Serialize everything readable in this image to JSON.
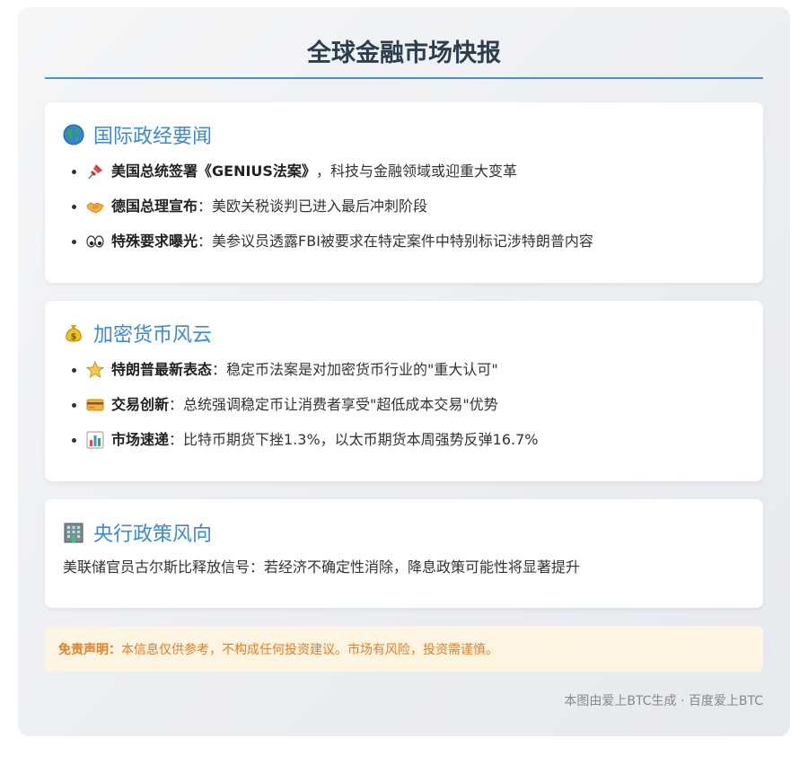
{
  "header": {
    "title": "全球金融市场快报"
  },
  "sections": [
    {
      "icon": "globe-icon",
      "title": "国际政经要闻",
      "items": [
        {
          "icon": "pushpin-icon",
          "bold": "美国总统签署《GENIUS法案》",
          "text": "，科技与金融领域或迎重大变革"
        },
        {
          "icon": "handshake-icon",
          "bold": "德国总理宣布",
          "text": "：美欧关税谈判已进入最后冲刺阶段"
        },
        {
          "icon": "eyes-icon",
          "bold": "特殊要求曝光",
          "text": "：美参议员透露FBI被要求在特定案件中特别标记涉特朗普内容"
        }
      ]
    },
    {
      "icon": "money-bag-icon",
      "title": "加密货币风云",
      "items": [
        {
          "icon": "star-icon",
          "bold": "特朗普最新表态",
          "text": "：稳定币法案是对加密货币行业的\"重大认可\""
        },
        {
          "icon": "credit-card-icon",
          "bold": "交易创新",
          "text": "：总统强调稳定币让消费者享受\"超低成本交易\"优势"
        },
        {
          "icon": "bar-chart-icon",
          "bold": "市场速递",
          "text": "：比特币期货下挫1.3%，以太币期货本周强势反弹16.7%"
        }
      ]
    },
    {
      "icon": "office-building-icon",
      "title": "央行政策风向",
      "text": "美联储官员古尔斯比释放信号：若经济不确定性消除，降息政策可能性将显著提升"
    }
  ],
  "disclaimer": {
    "label": "免责声明：",
    "text": "本信息仅供参考，不构成任何投资建议。市场有风险，投资需谨慎。"
  },
  "footer": {
    "text": "本图由爱上BTC生成 · 百度爱上BTC"
  },
  "colors": {
    "title": "#2c3e50",
    "accent": "#4a90d9",
    "section_title": "#3a8ad6",
    "disclaimer_bg": "#fdf5e1",
    "disclaimer_text": "#e67e22"
  }
}
